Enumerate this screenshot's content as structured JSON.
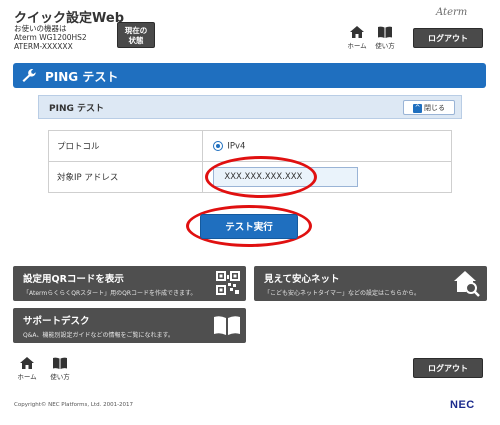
{
  "header": {
    "app_title": "クイック設定Web",
    "device_line1": "お使いの機器は",
    "device_line2": "Aterm WG1200HS2",
    "device_line3": "ATERM-XXXXXX",
    "status_button_line1": "現在の",
    "status_button_line2": "状態",
    "brand": "Aterm",
    "home_label": "ホーム",
    "help_label": "使い方",
    "logout_label": "ログアウト"
  },
  "page": {
    "title": "PING テスト"
  },
  "panel": {
    "title": "PING テスト",
    "collapse_label": "閉じる"
  },
  "form": {
    "protocol_label": "プロトコル",
    "protocol_value": "IPv4",
    "target_label": "対象IP アドレス",
    "target_value": "XXX.XXX.XXX.XXX"
  },
  "actions": {
    "run_test_label": "テスト実行"
  },
  "tiles": [
    {
      "title": "設定用QRコードを表示",
      "desc": "「AtermらくらくQRスタート」用のQRコードを作成できます。",
      "icon": "qr-code-icon"
    },
    {
      "title": "見えて安心ネット",
      "desc": "「こども安心ネットタイマー」などの設定はこちらから。",
      "icon": "house-search-icon"
    },
    {
      "title": "サポートデスク",
      "desc": "Q&A、機能別設定ガイドなどの情報をご覧になれます。",
      "icon": "book-icon"
    }
  ],
  "footer": {
    "home_label": "ホーム",
    "help_label": "使い方",
    "logout_label": "ログアウト",
    "copyright": "Copyright© NEC Platforms, Ltd. 2001-2017",
    "nec_logo": "NEC"
  },
  "colors": {
    "primary_blue": "#1f6fbf",
    "dark_gray": "#4f4f4f",
    "highlight_red": "#e01010"
  }
}
